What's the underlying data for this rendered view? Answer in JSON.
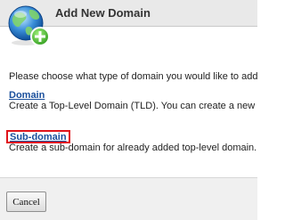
{
  "dialog": {
    "title": "Add New Domain",
    "icon": "globe-add-icon"
  },
  "content": {
    "intro": "Please choose what type of domain you would like to add",
    "options": [
      {
        "link": "Domain",
        "description": "Create a Top-Level Domain (TLD). You can create a new"
      },
      {
        "link": "Sub-domain",
        "description": "Create a sub-domain for already added top-level domain."
      }
    ]
  },
  "footer": {
    "cancel_label": "Cancel"
  },
  "colors": {
    "title_bar": "#e9e9e9",
    "link": "#1a4f9c",
    "highlight_border": "#e0141b"
  }
}
